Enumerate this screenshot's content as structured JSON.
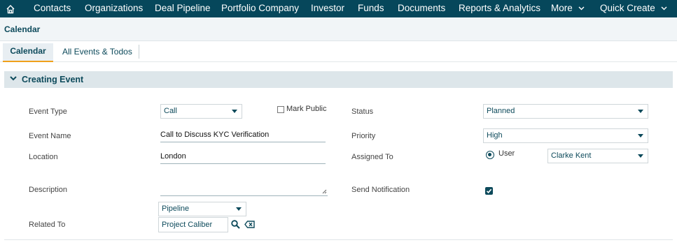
{
  "nav": {
    "items": [
      "Contacts",
      "Organizations",
      "Deal Pipeline",
      "Portfolio Company",
      "Investor",
      "Funds",
      "Documents",
      "Reports & Analytics"
    ],
    "more_label": "More",
    "quick_create_label": "Quick Create",
    "bg_color": "#06475b"
  },
  "module": {
    "title": "Calendar"
  },
  "tabs": {
    "active": "Calendar",
    "other": "All Events & Todos"
  },
  "section": {
    "title": "Creating Event"
  },
  "form": {
    "event_type": {
      "label": "Event Type",
      "value": "Call"
    },
    "mark_public": {
      "label": "Mark Public",
      "checked": false
    },
    "status": {
      "label": "Status",
      "value": "Planned"
    },
    "event_name": {
      "label": "Event Name",
      "value": "Call to Discuss KYC Verification"
    },
    "priority": {
      "label": "Priority",
      "value": "High"
    },
    "location": {
      "label": "Location",
      "value": "London"
    },
    "assigned_to": {
      "label": "Assigned To",
      "radio_label": "User",
      "value": "Clarke Kent"
    },
    "description": {
      "label": "Description",
      "value": ""
    },
    "send_notification": {
      "label": "Send Notification",
      "checked": true
    },
    "related_to": {
      "label": "Related To",
      "module_value": "Pipeline",
      "record_value": "Project Caliber"
    }
  },
  "colors": {
    "accent": "#0d4a5b",
    "tab_underline": "#f0a11b"
  }
}
